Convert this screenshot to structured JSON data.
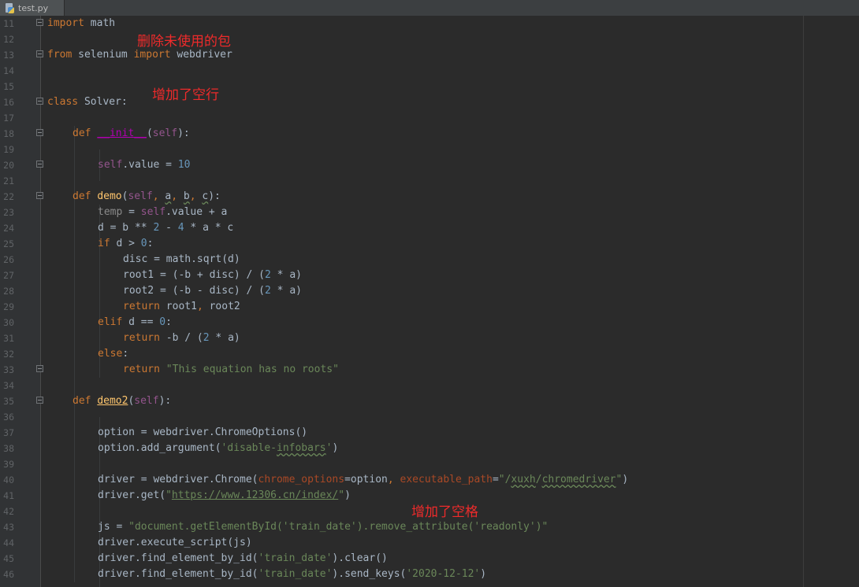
{
  "tab": {
    "label": "test.py",
    "icon": "python-file-icon"
  },
  "line_numbers": [
    "11",
    "12",
    "13",
    "14",
    "15",
    "16",
    "17",
    "18",
    "19",
    "20",
    "21",
    "22",
    "23",
    "24",
    "25",
    "26",
    "27",
    "28",
    "29",
    "30",
    "31",
    "32",
    "33",
    "34",
    "35",
    "36",
    "37",
    "38",
    "39",
    "40",
    "41",
    "42",
    "43",
    "44",
    "45",
    "46"
  ],
  "code": {
    "l11": {
      "t1": "import",
      "t2": " math"
    },
    "l13": {
      "t1": "from",
      "t2": " selenium ",
      "t3": "import",
      "t4": " webdriver"
    },
    "l16": {
      "t1": "class",
      "t2": " Solver:"
    },
    "l18": {
      "t1": "def ",
      "t2": "__init__",
      "t3": "(",
      "t4": "self",
      "t5": "):"
    },
    "l20": {
      "t1": "self",
      "t2": ".value = ",
      "t3": "10"
    },
    "l22": {
      "t1": "def ",
      "t2": "demo",
      "t3": "(",
      "t4": "self",
      "t5": ", ",
      "t6": "a",
      "t7": ", ",
      "t8": "b",
      "t9": ", ",
      "t10": "c",
      "t11": "):"
    },
    "l23": {
      "t1": "temp",
      "t2": " = ",
      "t3": "self",
      "t4": ".value + a"
    },
    "l24": {
      "t1": "d = b ** ",
      "t2": "2",
      "t3": " - ",
      "t4": "4",
      "t5": " * a * c"
    },
    "l25": {
      "t1": "if",
      "t2": " d > ",
      "t3": "0",
      "t4": ":"
    },
    "l26": {
      "t1": "disc = math.sqrt(d)"
    },
    "l27": {
      "t1": "root1 = (-b + disc) / (",
      "t2": "2",
      "t3": " * a)"
    },
    "l28": {
      "t1": "root2 = (-b - disc) / (",
      "t2": "2",
      "t3": " * a)"
    },
    "l29": {
      "t1": "return",
      "t2": " root1",
      "t3": ",",
      "t4": " root2"
    },
    "l30": {
      "t1": "elif",
      "t2": " d == ",
      "t3": "0",
      "t4": ":"
    },
    "l31": {
      "t1": "return",
      "t2": " -b / (",
      "t3": "2",
      "t4": " * a)"
    },
    "l32": {
      "t1": "else",
      "t2": ":"
    },
    "l33": {
      "t1": "return",
      "t2": " ",
      "t3": "\"This equation has no roots\""
    },
    "l35": {
      "t1": "def ",
      "t2": "demo2",
      "t3": "(",
      "t4": "self",
      "t5": "):"
    },
    "l37": {
      "t1": "option = webdriver.ChromeOptions()"
    },
    "l38": {
      "t1": "option.add_argument(",
      "t2": "'disable-",
      "t3": "infobars",
      "t4": "'",
      "t5": ")"
    },
    "l40": {
      "t1": "driver = webdriver.Chrome(",
      "t2": "chrome_options",
      "t3": "=option",
      "t4": ", ",
      "t5": "executable_path",
      "t6": "=",
      "t7": "\"/",
      "t8": "xuxh",
      "t9": "/",
      "t10": "chromedriver",
      "t11": "\"",
      "t12": ")"
    },
    "l41": {
      "t1": "driver.get(",
      "t2": "\"",
      "t3": "https://www.12306.cn/index/",
      "t4": "\"",
      "t5": ")"
    },
    "l43": {
      "t1": "js = ",
      "t2": "\"document.getElementById('train_date').remove_attribute('readonly')\""
    },
    "l44": {
      "t1": "driver.execute_script(js)"
    },
    "l45": {
      "t1": "driver.find_element_by_id(",
      "t2": "'train_date'",
      "t3": ").clear()"
    },
    "l46": {
      "t1": "driver.find_element_by_id(",
      "t2": "'train_date'",
      "t3": ").send_keys(",
      "t4": "'2020-12-12'",
      "t5": ")"
    }
  },
  "annotations": {
    "removed_imports": "删除未使用的包",
    "added_blank_line": "增加了空行",
    "added_spaces": "增加了空格"
  },
  "colors": {
    "background": "#2b2b2b",
    "keyword": "#cc7832",
    "self": "#94558d",
    "function": "#ffc66d",
    "string": "#6a8759",
    "number": "#6897bb",
    "annotation": "#ee2b2b"
  }
}
